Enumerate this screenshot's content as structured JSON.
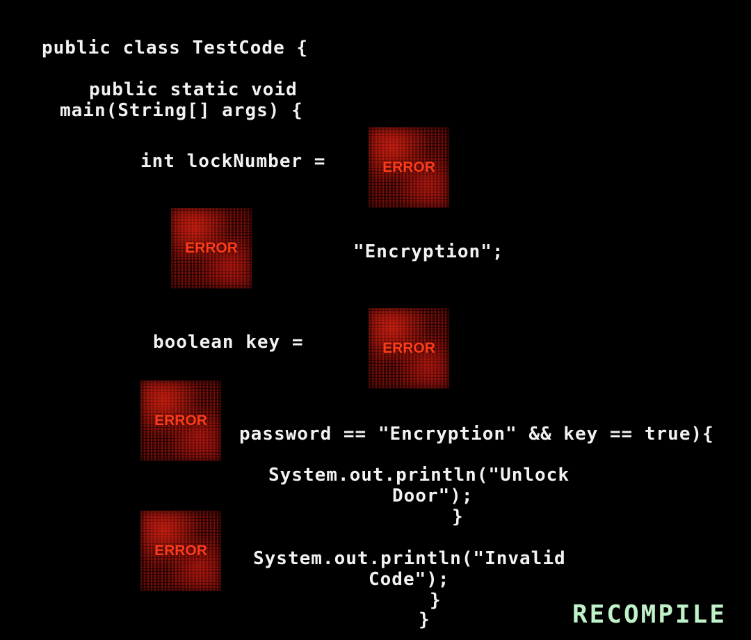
{
  "code_lines": {
    "class_decl": "public class TestCode {",
    "main_decl_1": "public static void",
    "main_decl_2": "main(String[] args) {",
    "lock_number": "int lockNumber =",
    "encryption_literal": "\"Encryption\";",
    "boolean_key": "boolean key =",
    "if_condition": "password == \"Encryption\" && key == true){",
    "println_unlock_1": "System.out.println(\"Unlock",
    "println_unlock_2": "Door\");",
    "close_brace_1": "}",
    "println_invalid_1": "System.out.println(\"Invalid",
    "println_invalid_2": "Code\");",
    "close_brace_2": "}",
    "close_brace_3": "}"
  },
  "error_slots": [
    {
      "label": "ERROR"
    },
    {
      "label": "ERROR"
    },
    {
      "label": "ERROR"
    },
    {
      "label": "ERROR"
    },
    {
      "label": "ERROR"
    }
  ],
  "recompile_label": "RECOMPILE",
  "colors": {
    "background": "#000000",
    "code_text": "#f2f2f2",
    "error_text": "#ff3b1a",
    "recompile": "#bff2c9"
  }
}
